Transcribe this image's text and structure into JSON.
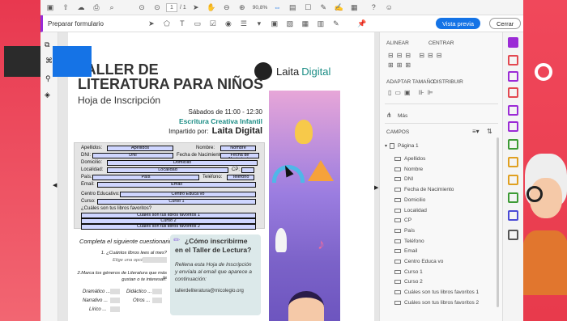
{
  "toolbar": {
    "page_current": "1",
    "page_total": "/ 1",
    "zoom": "90,8%",
    "mode_label": "Preparar formulario",
    "preview_label": "Vista previa",
    "close_label": "Cerrar"
  },
  "document": {
    "title_line1": "TALLER DE",
    "title_line2": "LITERATURA PARA NIÑOS",
    "subtitle": "Hoja de Inscripción",
    "logo_text_bold": "Laita",
    "logo_text_light": "Digital",
    "schedule": "Sábados de 11:00 - 12:30",
    "course": "Escritura Creativa Infantil",
    "taught_by": "Impartido por:",
    "taught_by_name": "Laita Digital",
    "labels": {
      "apellidos": "Apellidos:",
      "nombre": "Nombre:",
      "dni": "DNI:",
      "fecha": "Fecha de Nacimiento:",
      "domicilio": "Domicilio:",
      "localidad": "Localidad:",
      "cp": "CP:",
      "pais": "País:",
      "telefono": "Teléfono:",
      "email": "Email:",
      "centro": "Centro Educativo:",
      "curso": "Curso:",
      "libros": "¿Cuáles son tus libros favoritos?"
    },
    "fields": {
      "apellidos": "Apellidos",
      "nombre": "Nombre",
      "dni": "DNI",
      "fecha": "Fecha de Nacimiento",
      "domicilio": "Domicilio",
      "localidad": "Localidad",
      "pais": "País",
      "telefono": "Teléfono",
      "email": "Email",
      "centro": "Centro Educa vo",
      "curso1": "Curso 1",
      "libros1": "Cuáles son tus libros favoritos 1",
      "curso2": "Curso 2",
      "libros2": "Cuáles son tus libros favoritos 2"
    },
    "questionnaire_title": "Completa el siguiente cuestionario:",
    "q1": "1. ¿Cuántos libros lees al mes?",
    "q1_option": "Elige una opción:",
    "q2_line1": "2.Marca los géneros de Literatura que más te",
    "q2_line2": "gustan o te interesan:",
    "genre_dramatico": "Dramático ...",
    "genre_didactico": "Didáctico ...",
    "genre_narrativo": "Narrativo ...",
    "genre_otros": "Otros ...",
    "genre_lirico": "Lírico ...",
    "how_title_line1": "¿Cómo inscribirme",
    "how_title_line2": "en el Taller de Lectura?",
    "how_body_line1": "Rellena esta Hoja de Inscripción",
    "how_body_line2": "y envíala al email que aparece a",
    "how_body_line3": "continuación:",
    "how_email": "tallerdeliteratura@micolegio.org"
  },
  "panel": {
    "alinear": "ALINEAR",
    "centrar": "CENTRAR",
    "adaptar": "ADAPTAR TAMAÑO",
    "distribuir": "DISTRIBUIR",
    "mas": "Más",
    "campos": "CAMPOS",
    "pagina": "Página 1",
    "fields": [
      "Apellidos",
      "Nombre",
      "DNI",
      "Fecha de Nacimiento",
      "Domicilio",
      "Localidad",
      "CP",
      "País",
      "Teléfono",
      "Email",
      "Centro Educa vo",
      "Curso 1",
      "Curso 2",
      "Cuáles son tus libros favoritos 1",
      "Cuáles son tus libros favoritos 2"
    ]
  },
  "colors": {
    "accent_blue": "#1473e6",
    "purple": "#9b2bd6",
    "teal": "#1a8c84",
    "field_fill": "#cfd6ff"
  }
}
